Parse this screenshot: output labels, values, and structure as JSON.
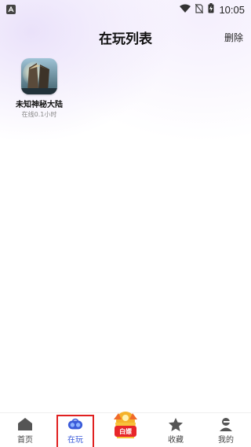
{
  "status_bar": {
    "time": "10:05",
    "app_icon": "a-letter-icon",
    "icons": [
      "wifi-icon",
      "no-sim-icon",
      "battery-charging-icon"
    ]
  },
  "header": {
    "title": "在玩列表",
    "delete_label": "删除"
  },
  "games": [
    {
      "name": "未知神秘大陆",
      "status": "在线0.1小时",
      "icon": "game-thumbnail-icon"
    }
  ],
  "tabbar": {
    "tabs": [
      {
        "label": "首页",
        "icon": "home-icon"
      },
      {
        "label": "在玩",
        "icon": "gamepad-icon",
        "active": true
      },
      {
        "label": "白嫖",
        "icon": "gift-box-icon"
      },
      {
        "label": "收藏",
        "icon": "star-icon"
      },
      {
        "label": "我的",
        "icon": "user-icon"
      }
    ]
  },
  "colors": {
    "accent": "#3a5bd9",
    "highlight_box": "#e02020",
    "promo_red": "#e8262a",
    "promo_gold": "#f5b22a"
  }
}
